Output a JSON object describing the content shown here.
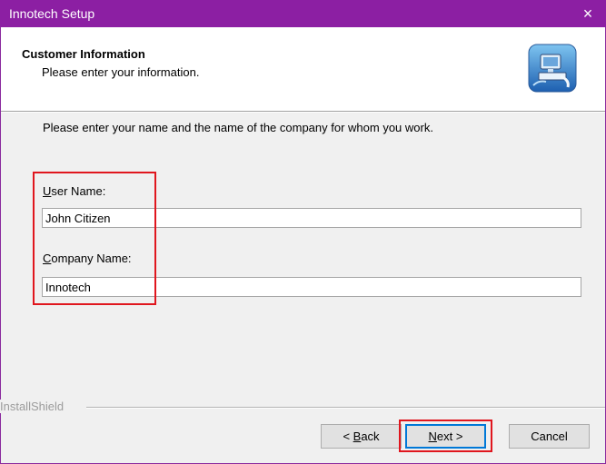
{
  "window": {
    "title": "Innotech Setup",
    "close_glyph": "×"
  },
  "header": {
    "title": "Customer Information",
    "subtitle": "Please enter your information.",
    "logo_icon": "computer-setup-icon"
  },
  "form": {
    "instruction": "Please enter your name and the name of the company for whom you work.",
    "user_label_mnemonic": "U",
    "user_label_rest": "ser Name:",
    "user_value": "John Citizen",
    "company_label_mnemonic": "C",
    "company_label_rest": "ompany Name:",
    "company_value": "Innotech"
  },
  "footer": {
    "brand": "InstallShield",
    "back_prefix": "< ",
    "back_mnemonic": "B",
    "back_rest": "ack",
    "next_mnemonic": "N",
    "next_rest": "ext >",
    "cancel_label": "Cancel"
  },
  "colors": {
    "titlebar": "#8c1fa3",
    "highlight": "#e0161e",
    "dialog_bg": "#f0f0f0"
  }
}
